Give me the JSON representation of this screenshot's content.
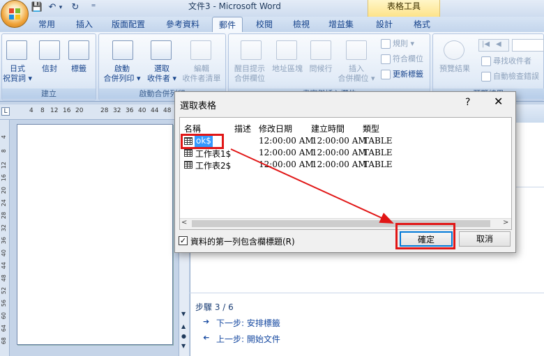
{
  "window": {
    "title": "文件3 - Microsoft Word",
    "context_tab": "表格工具"
  },
  "qat": {
    "save_glyph": "💾",
    "undo_glyph": "↶",
    "undo_more": "▾",
    "redo_glyph": "↻",
    "customize": "⁼"
  },
  "tabs": [
    {
      "label": "常用"
    },
    {
      "label": "插入"
    },
    {
      "label": "版面配置"
    },
    {
      "label": "參考資料"
    },
    {
      "label": "郵件"
    },
    {
      "label": "校閱"
    },
    {
      "label": "檢視"
    },
    {
      "label": "增益集"
    },
    {
      "label": "設計"
    },
    {
      "label": "格式"
    }
  ],
  "ribbon": {
    "group_create": {
      "label": "建立",
      "envelopes": "信封",
      "labels": "標籤",
      "chinese_env_line1": "日式",
      "chinese_env_line2": "祝賀詞 ▾"
    },
    "group_start": {
      "label": "啟動合併列印",
      "start_line1": "啟動",
      "start_line2": "合併列印 ▾",
      "select_line1": "選取",
      "select_line2": "收件者 ▾",
      "edit_line1": "編輯",
      "edit_line2": "收件者清單"
    },
    "group_fields": {
      "label": "書寫與插入欄位",
      "highlight_line1": "醒目提示",
      "highlight_line2": "合併欄位",
      "address_block": "地址區塊",
      "greeting_line": "問候行",
      "insert_line1": "插入",
      "insert_line2": "合併欄位 ▾",
      "rules": "規則 ▾",
      "match_fields": "符合欄位",
      "update_labels": "更新標籤"
    },
    "group_preview": {
      "label": "預覽結果",
      "preview_btn": "預覽結果",
      "find_recipient": "尋找收件者",
      "auto_check": "自動檢查錯誤"
    }
  },
  "ruler": {
    "h_ticks": [
      "4",
      "8",
      "12",
      "16",
      "20",
      "28",
      "32",
      "36",
      "40",
      "44",
      "48"
    ],
    "v_ticks": [
      "4",
      "8",
      "12",
      "16",
      "20",
      "24",
      "28",
      "32",
      "36",
      "40",
      "44",
      "48",
      "52",
      "56",
      "60",
      "64",
      "68"
    ]
  },
  "pane": {
    "step": "步驟 3 / 6",
    "next": "下一步: 安排標籤",
    "prev": "上一步: 開始文件"
  },
  "dialog": {
    "title": "選取表格",
    "help": "?",
    "close": "✕",
    "columns": [
      "名稱",
      "描述",
      "修改日期",
      "建立時間",
      "類型"
    ],
    "rows": [
      {
        "name": "ok$",
        "desc": "",
        "modified": "12:00:00 AM",
        "created": "12:00:00 AM",
        "type": "TABLE"
      },
      {
        "name": "工作表1$",
        "desc": "",
        "modified": "12:00:00 AM",
        "created": "12:00:00 AM",
        "type": "TABLE"
      },
      {
        "name": "工作表2$",
        "desc": "",
        "modified": "12:00:00 AM",
        "created": "12:00:00 AM",
        "type": "TABLE"
      }
    ],
    "checkbox_checked": true,
    "checkbox_mark": "✓",
    "checkbox_label": "資料的第一列包含欄標題(R)",
    "ok": "確定",
    "cancel": "取消",
    "scroll_left": "<",
    "scroll_right": ">"
  },
  "annotation": {
    "color": "#e11616"
  }
}
